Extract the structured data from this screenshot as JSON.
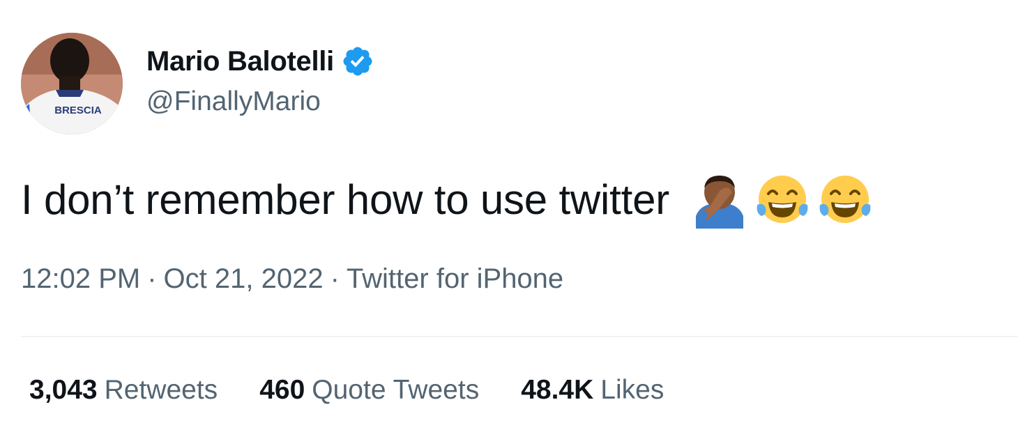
{
  "author": {
    "display_name": "Mario Balotelli",
    "handle": "@FinallyMario",
    "verified": true,
    "verified_color": "#1d9bf0",
    "avatar_text": "BRESCIA"
  },
  "tweet": {
    "text": "I don’t remember how to use twitter",
    "emojis": [
      "man-facepalming-emoji",
      "tears-of-joy-emoji",
      "tears-of-joy-emoji"
    ]
  },
  "meta": {
    "time": "12:02 PM",
    "separator": "·",
    "date": "Oct 21, 2022",
    "source": "Twitter for iPhone"
  },
  "stats": {
    "retweets": {
      "count": "3,043",
      "label": "Retweets"
    },
    "quotes": {
      "count": "460",
      "label": "Quote Tweets"
    },
    "likes": {
      "count": "48.4K",
      "label": "Likes"
    }
  },
  "colors": {
    "primary_text": "#0f1419",
    "secondary_text": "#536471",
    "divider": "#eff3f4"
  }
}
